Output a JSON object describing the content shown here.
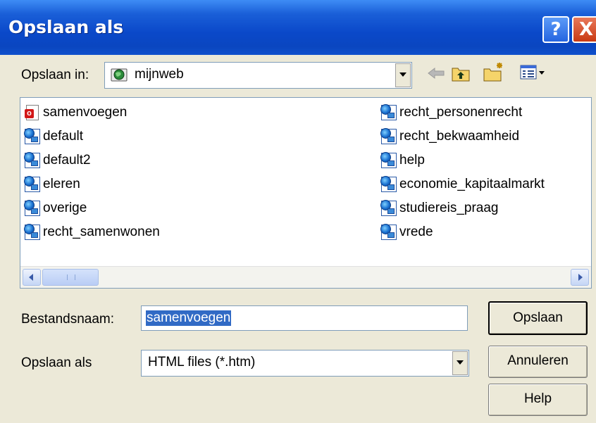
{
  "window": {
    "title": "Opslaan als",
    "help_glyph": "?",
    "close_glyph": "X"
  },
  "location": {
    "label": "Opslaan in:",
    "value": "mijnweb",
    "icon": "web-folder-icon"
  },
  "toolbar": {
    "icons": [
      "back-arrow-icon",
      "up-one-level-icon",
      "new-folder-icon",
      "view-menu-icon"
    ]
  },
  "files": {
    "left_column": [
      {
        "name": "samenvoegen",
        "icon": "word-doc-icon"
      },
      {
        "name": "default",
        "icon": "web-page-icon"
      },
      {
        "name": "default2",
        "icon": "web-page-icon"
      },
      {
        "name": "eleren",
        "icon": "web-page-icon"
      },
      {
        "name": "overige",
        "icon": "web-page-icon"
      },
      {
        "name": "recht_samenwonen",
        "icon": "web-page-icon"
      }
    ],
    "right_column": [
      {
        "name": "recht_personenrecht",
        "icon": "web-page-icon"
      },
      {
        "name": "recht_bekwaamheid",
        "icon": "web-page-icon"
      },
      {
        "name": "help",
        "icon": "web-page-icon"
      },
      {
        "name": "economie_kapitaalmarkt",
        "icon": "web-page-icon"
      },
      {
        "name": "studiereis_praag",
        "icon": "web-page-icon"
      },
      {
        "name": "vrede",
        "icon": "web-page-icon"
      }
    ]
  },
  "filename": {
    "label": "Bestandsnaam:",
    "value": "samenvoegen"
  },
  "filetype": {
    "label": "Opslaan als",
    "value": "HTML files (*.htm)"
  },
  "buttons": {
    "save": "Opslaan",
    "cancel": "Annuleren",
    "help": "Help"
  },
  "colors": {
    "titlebar": "#0a48c9",
    "selection": "#316ac5",
    "dialog_bg": "#ece9d8"
  }
}
